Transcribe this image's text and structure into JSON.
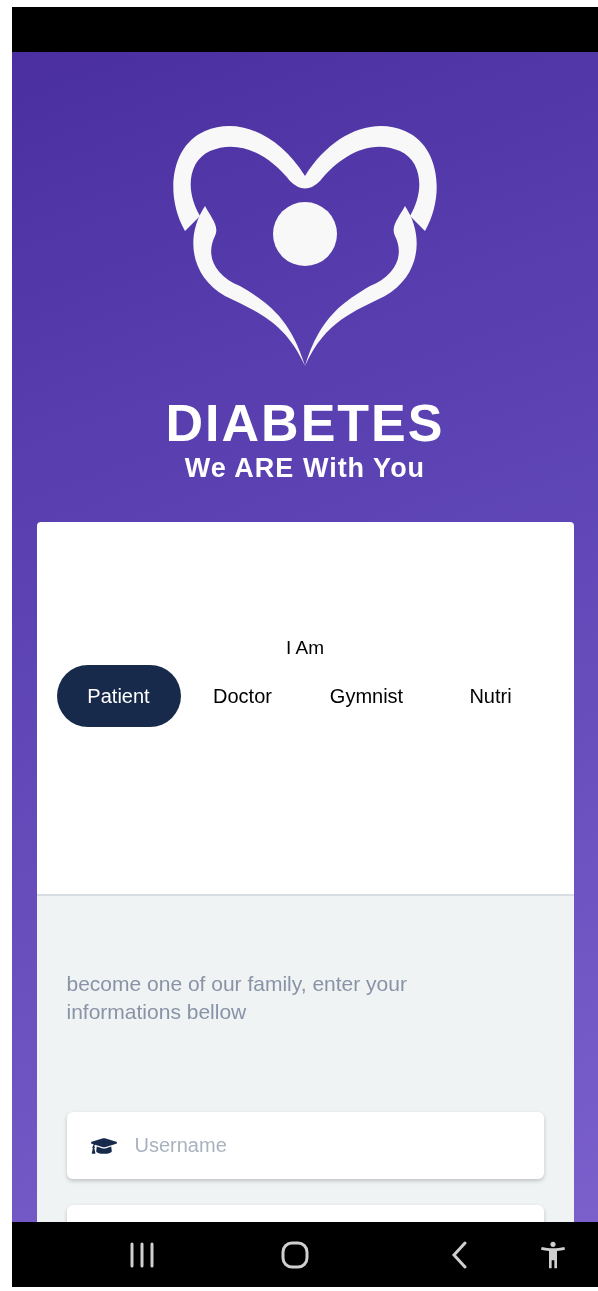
{
  "brand": {
    "title": "DIABETES",
    "tagline": "We ARE With You"
  },
  "role_picker": {
    "label": "I Am",
    "roles": [
      {
        "label": "Patient",
        "selected": true
      },
      {
        "label": "Doctor",
        "selected": false
      },
      {
        "label": "Gymnist",
        "selected": false
      },
      {
        "label": "Nutri",
        "selected": false
      }
    ]
  },
  "form": {
    "intro": "become one of our family, enter your informations bellow",
    "fields": [
      {
        "placeholder": "Username",
        "kind": "text"
      },
      {
        "kind": "partial"
      }
    ]
  }
}
